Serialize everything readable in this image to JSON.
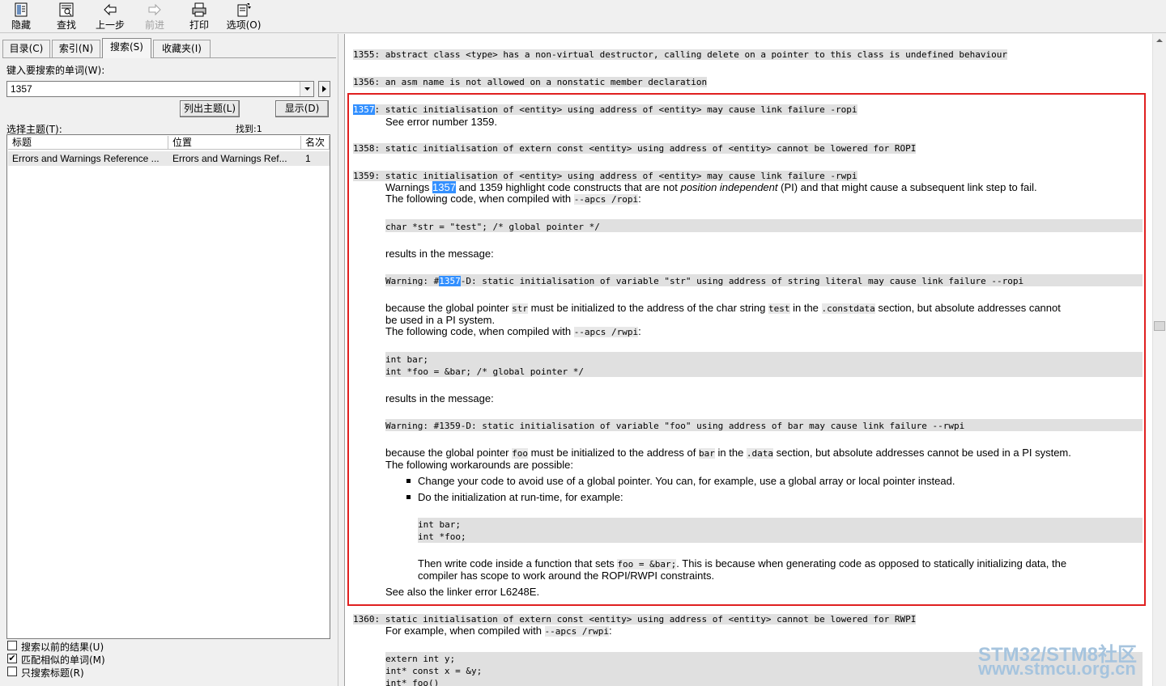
{
  "toolbar": {
    "hide": "隐藏",
    "find": "查找",
    "back": "上一步",
    "forward": "前进",
    "print": "打印",
    "options": "选项(O)"
  },
  "tabs": [
    "目录(C)",
    "索引(N)",
    "搜索(S)",
    "收藏夹(I)"
  ],
  "search": {
    "prompt": "键入要搜索的单词(W):",
    "value": "1357",
    "list_topics": "列出主题(L)",
    "display": "显示(D)",
    "select_topic": "选择主题(T):",
    "found": "找到:1",
    "columns": [
      "标题",
      "位置",
      "名次"
    ],
    "rows": [
      {
        "title": "Errors and Warnings Reference ...",
        "location": "Errors and Warnings Ref...",
        "rank": "1"
      }
    ],
    "options": [
      {
        "label": "搜索以前的结果(U)",
        "checked": false
      },
      {
        "label": "匹配相似的单词(M)",
        "checked": true
      },
      {
        "label": "只搜索标题(R)",
        "checked": false
      }
    ]
  },
  "content": {
    "l1355": "1355: abstract class <type> has a non-virtual destructor, calling delete on a pointer to this class is undefined behaviour",
    "l1356": "1356: an asm name is not allowed on a nonstatic member declaration",
    "l1357_num": "1357",
    "l1357_rest": ": static initialisation of <entity> using address of <entity> may cause link failure -ropi",
    "l1357_see": "See error number 1359.",
    "l1358": "1358: static initialisation of extern const <entity> using address of <entity> cannot be lowered for ROPI",
    "l1359": "1359: static initialisation of <entity> using address of <entity> may cause link failure -rwpi",
    "w_pre": "Warnings ",
    "w_num": "1357",
    "w_mid": " and 1359 highlight code constructs that are not ",
    "w_it": "position independent",
    "w_post": " (PI) and that might cause a subsequent link step to fail.",
    "fc1_pre": "The following code, when compiled with ",
    "fc1_code": "--apcs /ropi",
    "fc_colon": ":",
    "code1": "char *str = \"test\"; /* global pointer */",
    "results1": "results in the message:",
    "warn1_pre": "Warning: #",
    "warn1_num": "1357",
    "warn1_post": "-D: static initialisation of variable \"str\" using address of string literal may cause link failure --ropi",
    "bg1_a": "because the global pointer ",
    "bg1_b": "str",
    "bg1_c": " must be initialized to the address of the char string ",
    "bg1_d": "test",
    "bg1_e": " in the ",
    "bg1_f": ".constdata",
    "bg1_g": " section, but absolute addresses cannot",
    "bg1_line2": "be used in a PI system.",
    "fc2_pre": "The following code, when compiled with ",
    "fc2_code": "--apcs /rwpi",
    "code2_l1": "int bar;",
    "code2_l2": "int *foo = &bar; /* global pointer */",
    "results2": "results in the message:",
    "warn2": "Warning: #1359-D: static initialisation of variable \"foo\" using address of bar may cause link failure --rwpi",
    "bg2_a": "because the global pointer ",
    "bg2_b": "foo",
    "bg2_c": " must be initialized to the address of ",
    "bg2_d": "bar",
    "bg2_e": " in the ",
    "bg2_f": ".data",
    "bg2_g": " section, but absolute addresses cannot be used in a PI system.",
    "workarounds": "The following workarounds are possible:",
    "bullet1": "Change your code to avoid use of a global pointer. You can, for example, use a global array or local pointer instead.",
    "bullet2": "Do the initialization at run-time, for example:",
    "code3_l1": "int bar;",
    "code3_l2": "int *foo;",
    "then_a": "Then write code inside a function that sets ",
    "then_code": "foo = &bar;",
    "then_b": ". This is because when generating code as opposed to statically initializing data, the",
    "then_line2": "compiler has scope to work around the ROPI/RWPI constraints.",
    "see_also": "See also the linker error L6248E.",
    "l1360": "1360: static initialisation of extern const <entity> using address of <entity> cannot be lowered for RWPI",
    "fe_pre": "For example, when compiled with ",
    "fe_code": "--apcs /rwpi",
    "code4_l1": "extern int y;",
    "code4_l2": "int* const x = &y;",
    "code4_l3": "int* foo()"
  },
  "watermark": {
    "line1": "STM32/STM8社区",
    "line2": "www.stmcu.org.cn"
  },
  "colors": {
    "highlight": "#3390ff",
    "redbox": "#e02020",
    "code_bg": "#e0e0e0"
  }
}
